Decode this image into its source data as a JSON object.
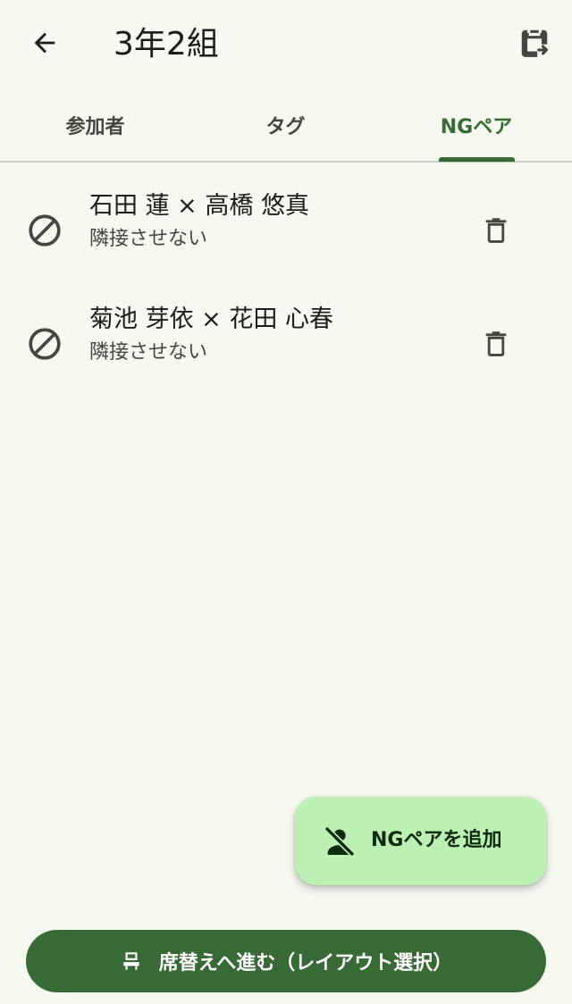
{
  "appbar": {
    "title": "3年2組",
    "back_icon": "arrow-left-icon",
    "export_icon": "clipboard-export-icon"
  },
  "tabs": [
    {
      "label": "参加者",
      "selected": false
    },
    {
      "label": "タグ",
      "selected": false
    },
    {
      "label": "NGペア",
      "selected": true
    }
  ],
  "ng_pairs": [
    {
      "names": "石田 蓮 × 高橋 悠真",
      "rule": "隣接させない",
      "icon": "block-icon",
      "delete_icon": "trash-icon"
    },
    {
      "names": "菊池 芽依 × 花田 心春",
      "rule": "隣接させない",
      "icon": "block-icon",
      "delete_icon": "trash-icon"
    }
  ],
  "fab": {
    "label": "NGペアを追加",
    "icon": "person-off-icon"
  },
  "bottom_button": {
    "label": "席替えへ進む（レイアウト選択）",
    "icon": "seat-icon"
  },
  "colors": {
    "background": "#f6f9f0",
    "primary": "#386a35",
    "fab": "#bdf0b3",
    "text": "#1b1d18",
    "muted": "#43483f"
  }
}
